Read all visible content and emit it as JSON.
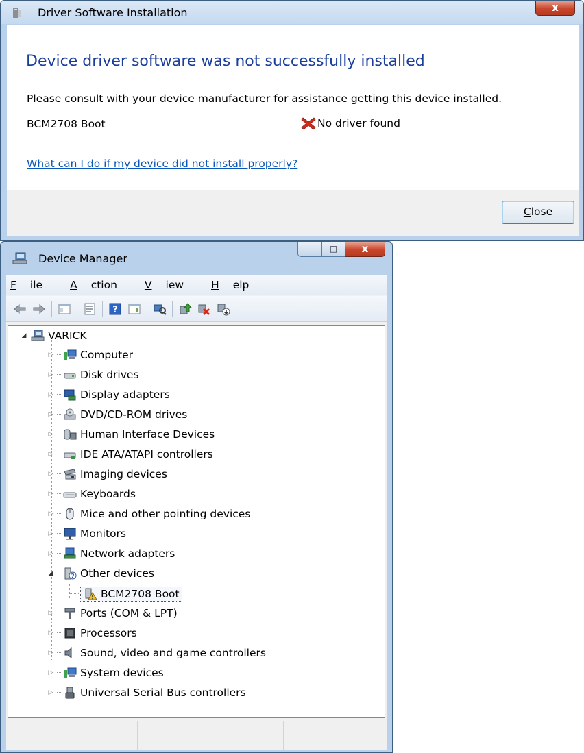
{
  "install_dialog": {
    "title": "Driver Software Installation",
    "close_glyph": "x",
    "heading": "Device driver software was not successfully installed",
    "message": "Please consult with your device manufacturer for assistance getting this device installed.",
    "device_name": "BCM2708 Boot",
    "status_icon": "red-x-icon",
    "status_text": "No driver found",
    "help_link": "What can I do if my device did not install properly?",
    "close_button_first": "C",
    "close_button_rest": "lose"
  },
  "device_manager": {
    "title": "Device Manager",
    "window_buttons": {
      "minimize": "–",
      "maximize": "□",
      "close": "x"
    },
    "menu": [
      {
        "first": "F",
        "rest": "ile"
      },
      {
        "first": "A",
        "rest": "ction"
      },
      {
        "first": "V",
        "rest": "iew"
      },
      {
        "first": "H",
        "rest": "elp"
      }
    ],
    "toolbar_icons": [
      "back-arrow-icon",
      "forward-arrow-icon",
      "show-hide-console-tree-icon",
      "properties-icon",
      "export-list-icon",
      "help-icon",
      "action-pane-icon",
      "scan-hardware-icon",
      "update-driver-icon",
      "uninstall-icon",
      "disable-device-icon"
    ],
    "tree": {
      "root": "VARICK",
      "categories": [
        {
          "label": "Computer",
          "icon": "computer-icon"
        },
        {
          "label": "Disk drives",
          "icon": "disk-drive-icon"
        },
        {
          "label": "Display adapters",
          "icon": "display-adapter-icon"
        },
        {
          "label": "DVD/CD-ROM drives",
          "icon": "dvd-drive-icon"
        },
        {
          "label": "Human Interface Devices",
          "icon": "hid-icon"
        },
        {
          "label": "IDE ATA/ATAPI controllers",
          "icon": "ide-controller-icon"
        },
        {
          "label": "Imaging devices",
          "icon": "imaging-device-icon"
        },
        {
          "label": "Keyboards",
          "icon": "keyboard-icon"
        },
        {
          "label": "Mice and other pointing devices",
          "icon": "mouse-icon"
        },
        {
          "label": "Monitors",
          "icon": "monitor-icon"
        },
        {
          "label": "Network adapters",
          "icon": "network-adapter-icon"
        },
        {
          "label": "Other devices",
          "icon": "unknown-device-icon",
          "expanded": true
        },
        {
          "label": "Ports (COM & LPT)",
          "icon": "port-icon"
        },
        {
          "label": "Processors",
          "icon": "processor-icon"
        },
        {
          "label": "Sound, video and game controllers",
          "icon": "sound-icon"
        },
        {
          "label": "System devices",
          "icon": "system-device-icon"
        },
        {
          "label": "Universal Serial Bus controllers",
          "icon": "usb-icon"
        }
      ],
      "child": {
        "label": "BCM2708 Boot",
        "icon": "warning-device-icon"
      }
    },
    "colors": {
      "title_bar": "#b9d1ea",
      "link": "#0a57b8",
      "heading": "#1a3e9c",
      "close_red": "#c9462c"
    }
  }
}
